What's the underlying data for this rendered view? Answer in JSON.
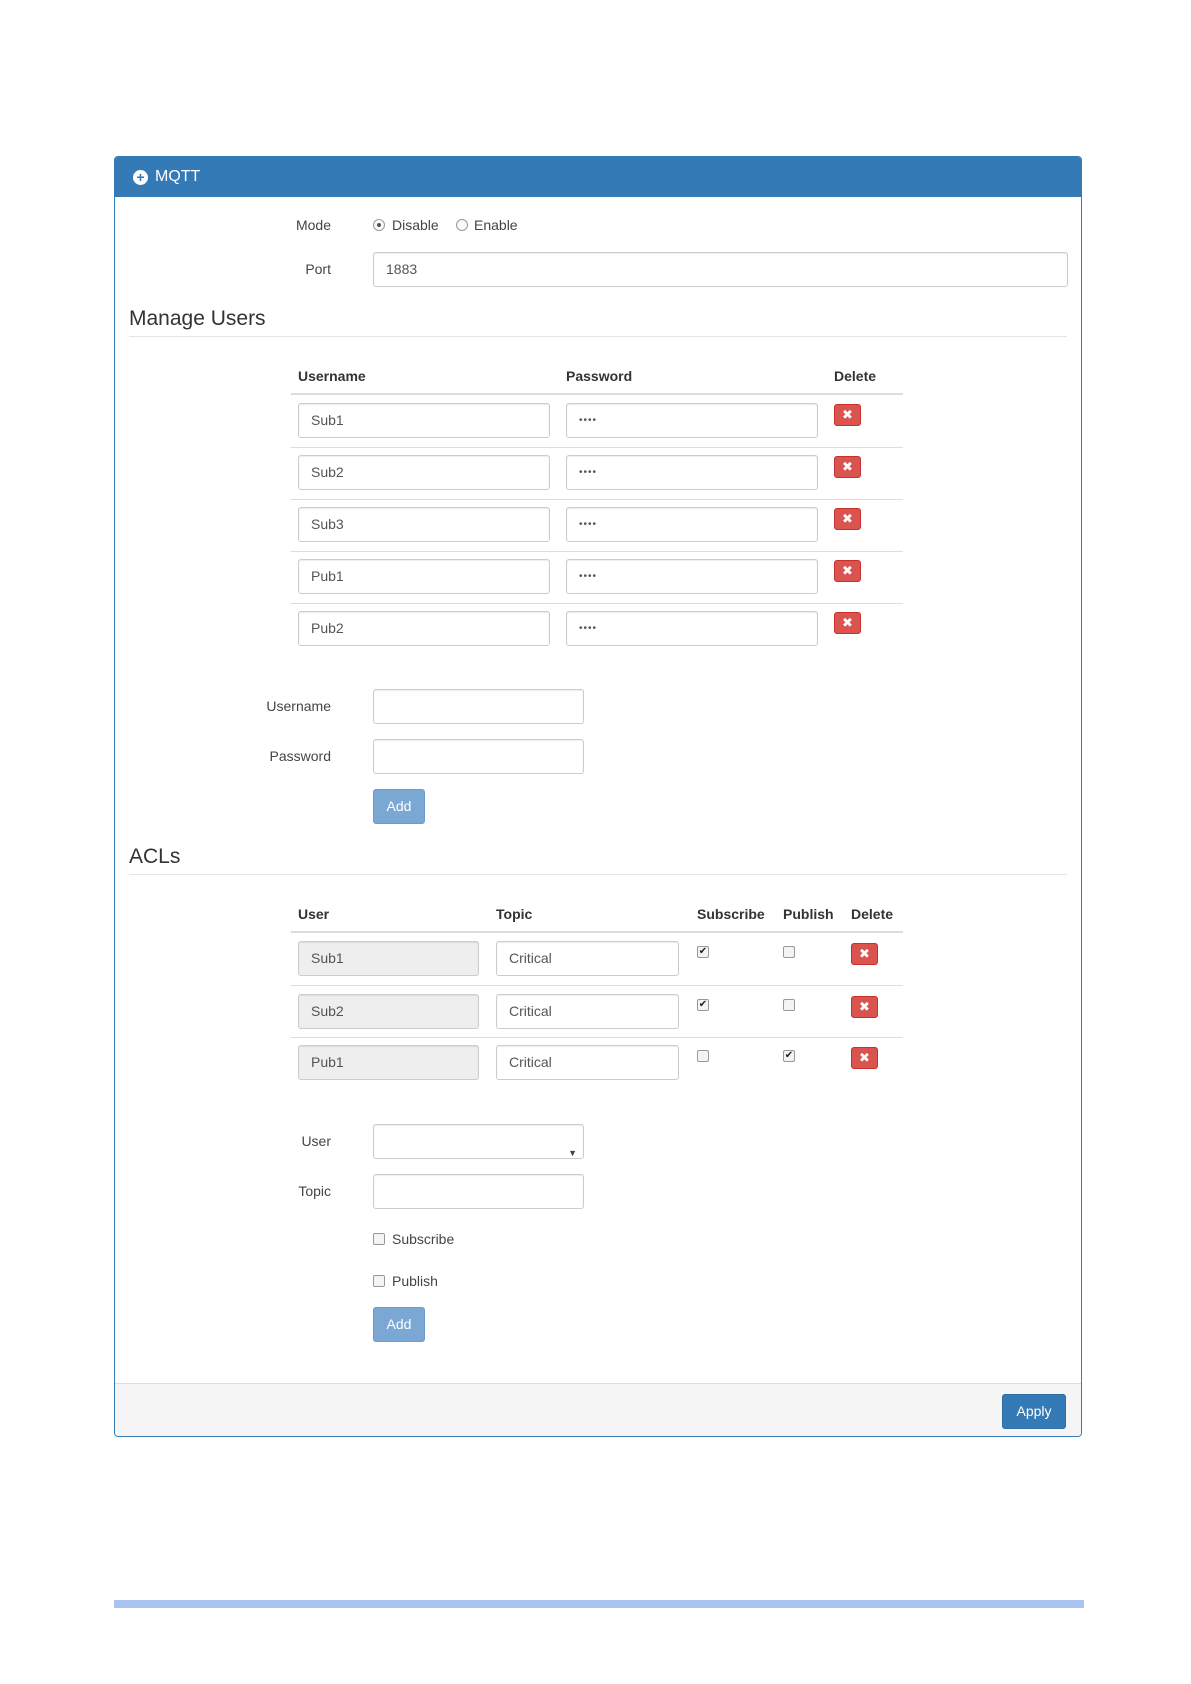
{
  "panel": {
    "title": "MQTT",
    "icon": "plus-circle-icon"
  },
  "mode": {
    "label": "Mode",
    "options": [
      {
        "label": "Disable",
        "selected": true
      },
      {
        "label": "Enable",
        "selected": false
      }
    ]
  },
  "port": {
    "label": "Port",
    "value": "1883"
  },
  "manage_users": {
    "title": "Manage Users",
    "columns": {
      "username": "Username",
      "password": "Password",
      "delete": "Delete"
    },
    "rows": [
      {
        "username": "Sub1",
        "password": "••••"
      },
      {
        "username": "Sub2",
        "password": "••••"
      },
      {
        "username": "Sub3",
        "password": "••••"
      },
      {
        "username": "Pub1",
        "password": "••••"
      },
      {
        "username": "Pub2",
        "password": "••••"
      }
    ],
    "delete_symbol": "✖",
    "form": {
      "username_label": "Username",
      "username_value": "",
      "password_label": "Password",
      "password_value": "",
      "add_label": "Add"
    }
  },
  "acls": {
    "title": "ACLs",
    "columns": {
      "user": "User",
      "topic": "Topic",
      "subscribe": "Subscribe",
      "publish": "Publish",
      "delete": "Delete"
    },
    "rows": [
      {
        "user": "Sub1",
        "topic": "Critical",
        "subscribe": true,
        "publish": false
      },
      {
        "user": "Sub2",
        "topic": "Critical",
        "subscribe": true,
        "publish": false
      },
      {
        "user": "Pub1",
        "topic": "Critical",
        "subscribe": false,
        "publish": true
      }
    ],
    "delete_symbol": "✖",
    "check_symbol": "✔",
    "form": {
      "user_label": "User",
      "user_value": "",
      "topic_label": "Topic",
      "topic_value": "",
      "subscribe_label": "Subscribe",
      "publish_label": "Publish",
      "add_label": "Add"
    }
  },
  "footer": {
    "apply_label": "Apply"
  },
  "colors": {
    "primary": "#337ab7",
    "danger": "#d9534f",
    "add_button": "#7aa7d3",
    "bottom_bar": "#a9c4f2"
  }
}
